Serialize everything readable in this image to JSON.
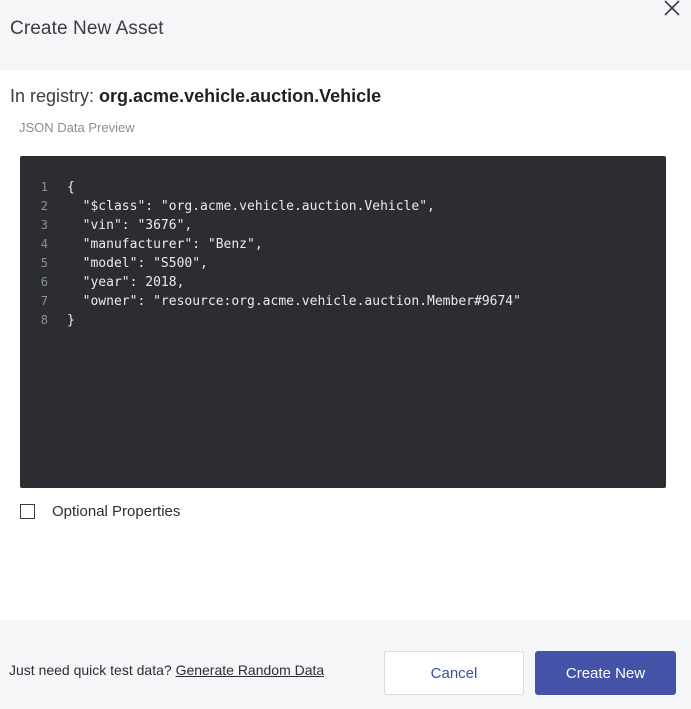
{
  "dialog": {
    "title": "Create New Asset",
    "close_icon": "close-icon"
  },
  "registry": {
    "prefix": "In registry: ",
    "name": "org.acme.vehicle.auction.Vehicle"
  },
  "preview": {
    "label": "JSON Data Preview",
    "lines": [
      {
        "no": "1",
        "text": "{"
      },
      {
        "no": "2",
        "text": "  \"$class\": \"org.acme.vehicle.auction.Vehicle\","
      },
      {
        "no": "3",
        "text": "  \"vin\": \"3676\","
      },
      {
        "no": "4",
        "text": "  \"manufacturer\": \"Benz\","
      },
      {
        "no": "5",
        "text": "  \"model\": \"S500\","
      },
      {
        "no": "6",
        "text": "  \"year\": 2018,"
      },
      {
        "no": "7",
        "text": "  \"owner\": \"resource:org.acme.vehicle.auction.Member#9674\""
      },
      {
        "no": "8",
        "text": "}"
      }
    ]
  },
  "optional_properties": {
    "label": "Optional Properties",
    "checked": false
  },
  "footer": {
    "quick_text": "Just need quick test data? ",
    "generate_link": "Generate Random Data",
    "cancel_label": "Cancel",
    "create_label": "Create New"
  },
  "colors": {
    "primary": "#4453a8",
    "editor_bg": "#2b2d33",
    "panel_bg": "#f5f6f8"
  }
}
